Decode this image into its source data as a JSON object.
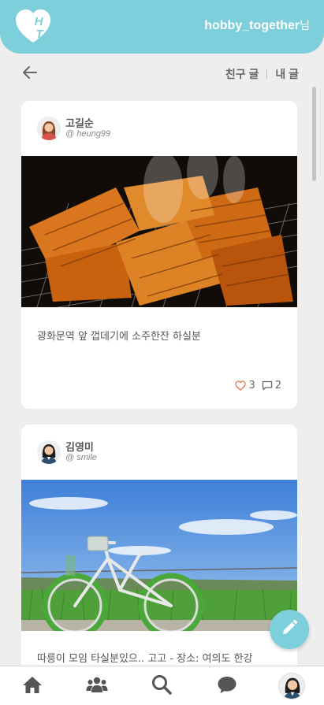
{
  "header": {
    "logo_text": "HT",
    "username": "hobby_together",
    "honorific": "님"
  },
  "filters": {
    "friends_posts": "친구 글",
    "my_posts": "내 글"
  },
  "posts": [
    {
      "author_name": "고길순",
      "author_handle": "@ heung99",
      "photo": "grilled-squid",
      "text": "광화문역 앞 껍데기에 소주한잔 하실분",
      "likes": "3",
      "comments": "2"
    },
    {
      "author_name": "김영미",
      "author_handle": "@ smile",
      "photo": "bicycle-by-river",
      "text": "따릉이 모임 타실분있으.. 고고 - 장소: 여의도 한강"
    }
  ],
  "icons": {
    "back": "arrow-left-icon",
    "like": "heart-icon",
    "comment": "speech-bubble-icon",
    "fab": "pencil-icon",
    "nav": [
      "home-icon",
      "friends-icon",
      "search-icon",
      "chat-icon",
      "profile-avatar"
    ]
  },
  "colors": {
    "accent": "#7ecfdc",
    "background": "#eeeeee",
    "heart": "#e07b50"
  }
}
